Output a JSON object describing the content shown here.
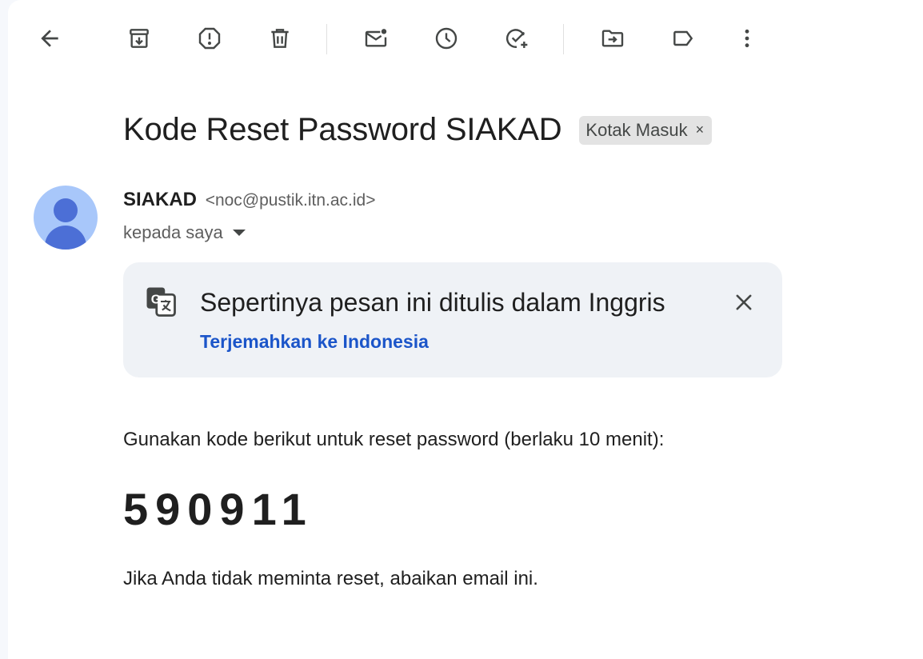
{
  "toolbar": {
    "buttons": [
      {
        "name": "back-arrow-icon"
      },
      {
        "name": "archive-icon"
      },
      {
        "name": "report-spam-icon"
      },
      {
        "name": "delete-icon"
      },
      {
        "name": "mark-unread-icon"
      },
      {
        "name": "snooze-clock-icon"
      },
      {
        "name": "add-to-tasks-icon"
      },
      {
        "name": "move-to-folder-icon"
      },
      {
        "name": "label-icon"
      },
      {
        "name": "more-vert-icon"
      }
    ]
  },
  "email": {
    "subject": "Kode Reset Password SIAKAD",
    "label_chip": "Kotak Masuk",
    "label_chip_close": "×",
    "sender_name": "SIAKAD",
    "sender_email": "<noc@pustik.itn.ac.id>",
    "recipient": "kepada saya"
  },
  "translate": {
    "icon": "translate-icon",
    "message": "Sepertinya pesan ini ditulis dalam Inggris",
    "link": "Terjemahkan ke Indonesia",
    "close_icon": "close-icon"
  },
  "body": {
    "line1": "Gunakan kode berikut untuk reset password (berlaku 10 menit):",
    "code": "590911",
    "line2": "Jika Anda tidak meminta reset, abaikan email ini."
  },
  "colors": {
    "link": "#1b55c9",
    "translate_bg": "#eff2f6",
    "avatar_bg": "#a8c7fa",
    "avatar_fg": "#4c6fd6",
    "chip_bg": "#e3e3e3"
  }
}
